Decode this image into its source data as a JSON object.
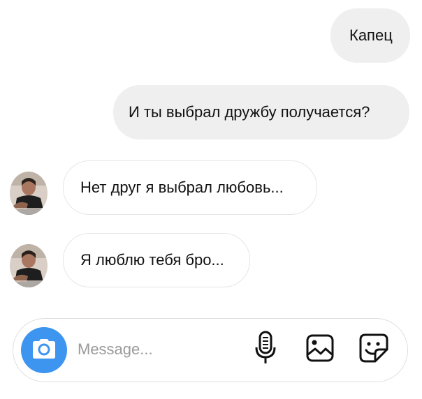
{
  "messages": [
    {
      "direction": "outgoing",
      "text": "Капец"
    },
    {
      "direction": "outgoing",
      "text": "И ты выбрал дружбу получается?"
    },
    {
      "direction": "incoming",
      "text": "Нет друг я выбрал любовь..."
    },
    {
      "direction": "incoming",
      "text": "Я люблю тебя бро..."
    }
  ],
  "composer": {
    "placeholder": "Message...",
    "accent": "#3d95ef"
  },
  "icons": {
    "camera": "camera-icon",
    "mic": "microphone-icon",
    "image": "image-icon",
    "sticker": "sticker-icon"
  }
}
